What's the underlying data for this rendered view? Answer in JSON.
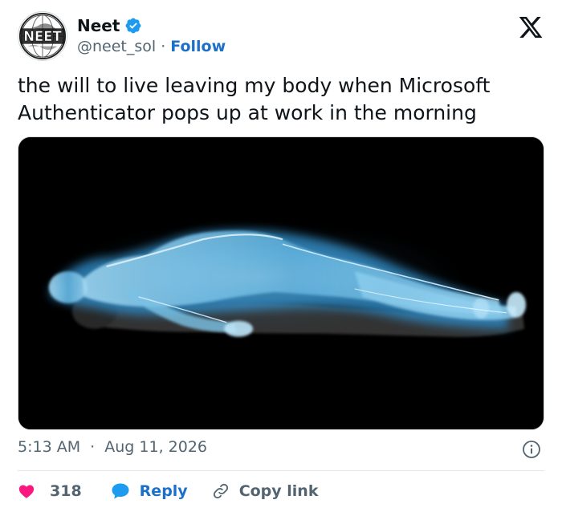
{
  "author": {
    "display_name": "Neet",
    "handle": "@neet_sol",
    "separator": "·",
    "follow_label": "Follow",
    "avatar_logo_text": "NEET",
    "verified": true
  },
  "tweet": {
    "text": "the will to live leaving my body when Microsoft Authenticator pops up at work in the morning"
  },
  "meta": {
    "time": "5:13 AM",
    "separator": "·",
    "date": "Aug 11, 2026"
  },
  "actions": {
    "like_count": "318",
    "reply_label": "Reply",
    "copy_link_label": "Copy link"
  },
  "icons": {
    "platform": "x-logo-icon",
    "verified": "verified-badge-icon",
    "info": "info-icon",
    "like": "heart-icon",
    "reply": "speech-bubble-icon",
    "copy": "link-icon"
  },
  "colors": {
    "accent": "#1d70c9",
    "like": "#f91880",
    "muted": "#536471",
    "text": "#0f1419",
    "verified": "#1d9bf0"
  }
}
